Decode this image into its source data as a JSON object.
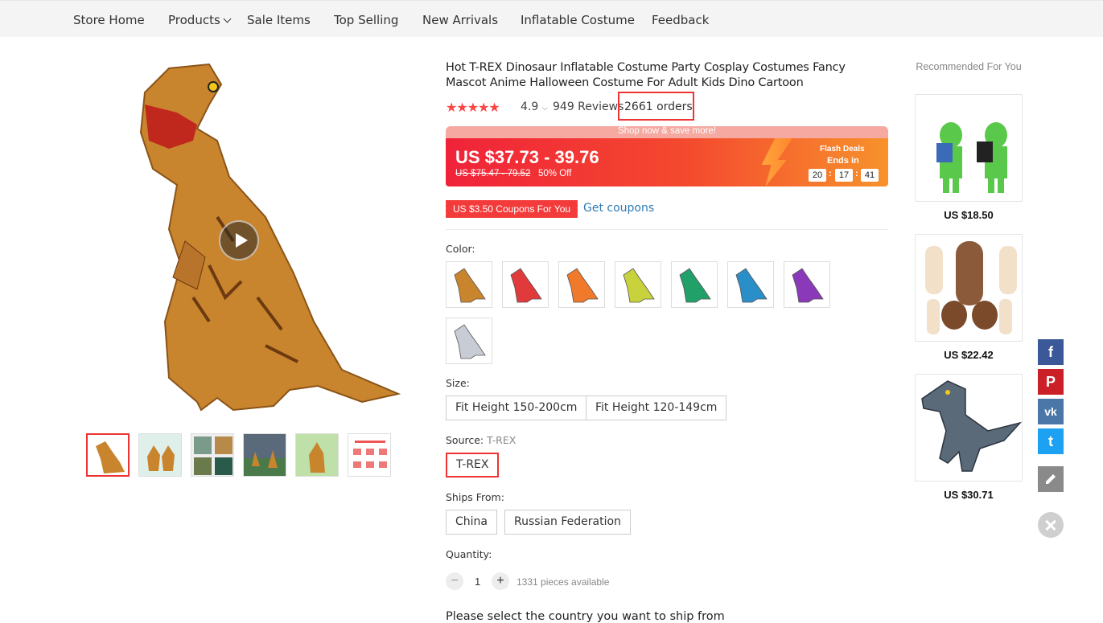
{
  "nav": {
    "items": [
      "Store Home",
      "Products",
      "Sale Items",
      "Top Selling",
      "New Arrivals",
      "Inflatable Costume",
      "Feedback"
    ]
  },
  "product": {
    "title": "Hot T-REX Dinosaur Inflatable Costume Party Cosplay Costumes Fancy Mascot Anime Halloween Costume For Adult Kids Dino Cartoon",
    "stars": "★★★★★",
    "rating": "4.9",
    "reviews": "949 Reviews",
    "orders": "2661 orders"
  },
  "flash": {
    "banner": "Shop now & save more!",
    "price": "US $37.73 - 39.76",
    "old_price": "US $75.47 - 79.52",
    "discount": "50% Off",
    "label": "Flash Deals",
    "ends_in": "Ends in",
    "hours": "20",
    "minutes": "17",
    "seconds": "41",
    "accent": "#f0223a"
  },
  "coupon": {
    "badge": "US $3.50 Coupons For You",
    "link": "Get coupons"
  },
  "options": {
    "color_label": "Color:",
    "color_swatches": [
      "#c9852e",
      "#e03a3a",
      "#f07a2a",
      "#c8d23c",
      "#22a06a",
      "#2a8ec9",
      "#8a3ab8",
      "#c8ccd4"
    ],
    "size_label": "Size:",
    "sizes": [
      "Fit Height 150-200cm",
      "Fit Height 120-149cm"
    ],
    "source_label": "Source:",
    "source_value": "T-REX",
    "sources": [
      "T-REX"
    ],
    "ships_label": "Ships From:",
    "ships": [
      "China",
      "Russian Federation"
    ],
    "quantity_label": "Quantity:",
    "quantity": "1",
    "minus": "−",
    "plus": "+",
    "available": "1331 pieces available",
    "ship_prompt": "Please select the country you want to ship from"
  },
  "recommended": {
    "title": "Recommended For You",
    "items": [
      {
        "price": "US $18.50"
      },
      {
        "price": "US $22.42"
      },
      {
        "price": "US $30.71"
      }
    ]
  },
  "social": {
    "facebook": "f",
    "pinterest": "P",
    "vk": "vk",
    "twitter": "t"
  }
}
